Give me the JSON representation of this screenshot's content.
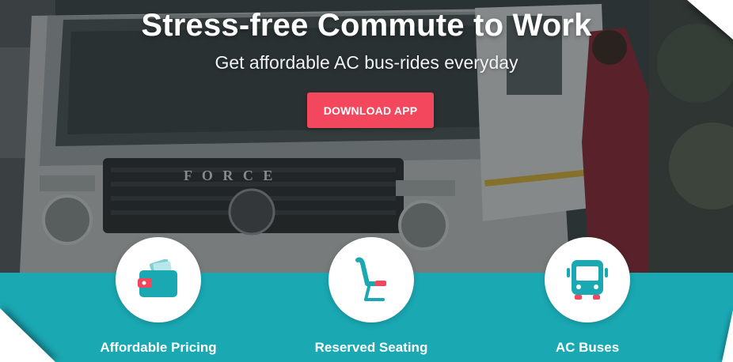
{
  "hero": {
    "title": "Stress-free Commute to Work",
    "subtitle": "Get affordable AC bus-rides everyday",
    "cta_label": "DOWNLOAD APP",
    "bus_brand": "F O R C E"
  },
  "features": [
    {
      "label": "Affordable Pricing",
      "icon": "wallet-icon"
    },
    {
      "label": "Reserved Seating",
      "icon": "seat-icon"
    },
    {
      "label": "AC Buses",
      "icon": "bus-icon"
    }
  ],
  "colors": {
    "accent": "#f2475c",
    "band": "#1aa8b3",
    "icon_primary": "#1aa8b3",
    "icon_secondary": "#f2475c"
  }
}
